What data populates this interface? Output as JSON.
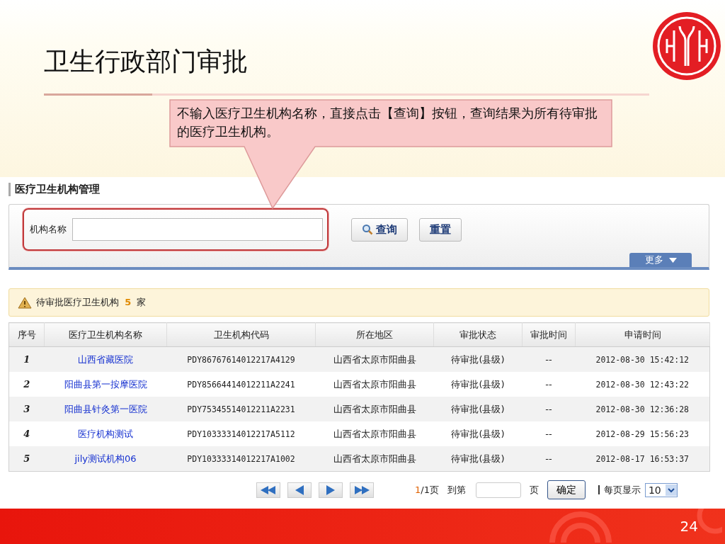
{
  "slide": {
    "title": "卫生行政部门审批",
    "page_number": "24"
  },
  "callout": {
    "text": "不输入医疗卫生机构名称，直接点击【查询】按钮，查询结果为所有待审批的医疗卫生机构。"
  },
  "panel": {
    "title": "医疗卫生机构管理"
  },
  "search": {
    "label": "机构名称",
    "highlighted": true,
    "buttons": [
      {
        "label": "查询",
        "kind": "search"
      },
      {
        "label": "重置",
        "kind": "plain"
      }
    ],
    "more_button": "更多"
  },
  "notice": {
    "text_before": "待审批医疗卫生机构",
    "count": "5",
    "text_after": "家"
  },
  "table": {
    "columns": [
      "序号",
      "医疗卫生机构名称",
      "卫生机构代码",
      "所在地区",
      "审批状态",
      "审批时间",
      "申请时间"
    ],
    "rows": [
      {
        "cells": [
          "1",
          "山西省藏医院",
          "PDY86767614012217A4129",
          "山西省太原市阳曲县",
          "待审批(县级)",
          "--",
          "2012-08-30 15:42:12"
        ]
      },
      {
        "cells": [
          "2",
          "阳曲县第一按摩医院",
          "PDY85664414012211A2241",
          "山西省太原市阳曲县",
          "待审批(县级)",
          "--",
          "2012-08-30 12:43:22"
        ]
      },
      {
        "cells": [
          "3",
          "阳曲县针灸第一医院",
          "PDY75345514012211A2231",
          "山西省太原市阳曲县",
          "待审批(县级)",
          "--",
          "2012-08-30 12:36:28"
        ]
      },
      {
        "cells": [
          "4",
          "医疗机构测试",
          "PDY10333314012217A5112",
          "山西省太原市阳曲县",
          "待审批(县级)",
          "--",
          "2012-08-29 15:56:23"
        ]
      },
      {
        "cells": [
          "5",
          "jily测试机构06",
          "PDY10333314012217A1002",
          "山西省太原市阳曲县",
          "待审批(县级)",
          "--",
          "2012-08-17 16:53:37"
        ]
      }
    ]
  },
  "pager": {
    "current": "1",
    "total": "/1页",
    "goto_label": "到第",
    "page_unit": "页",
    "confirm": "确定",
    "per_page_label": "每页显示",
    "per_page": "10"
  }
}
